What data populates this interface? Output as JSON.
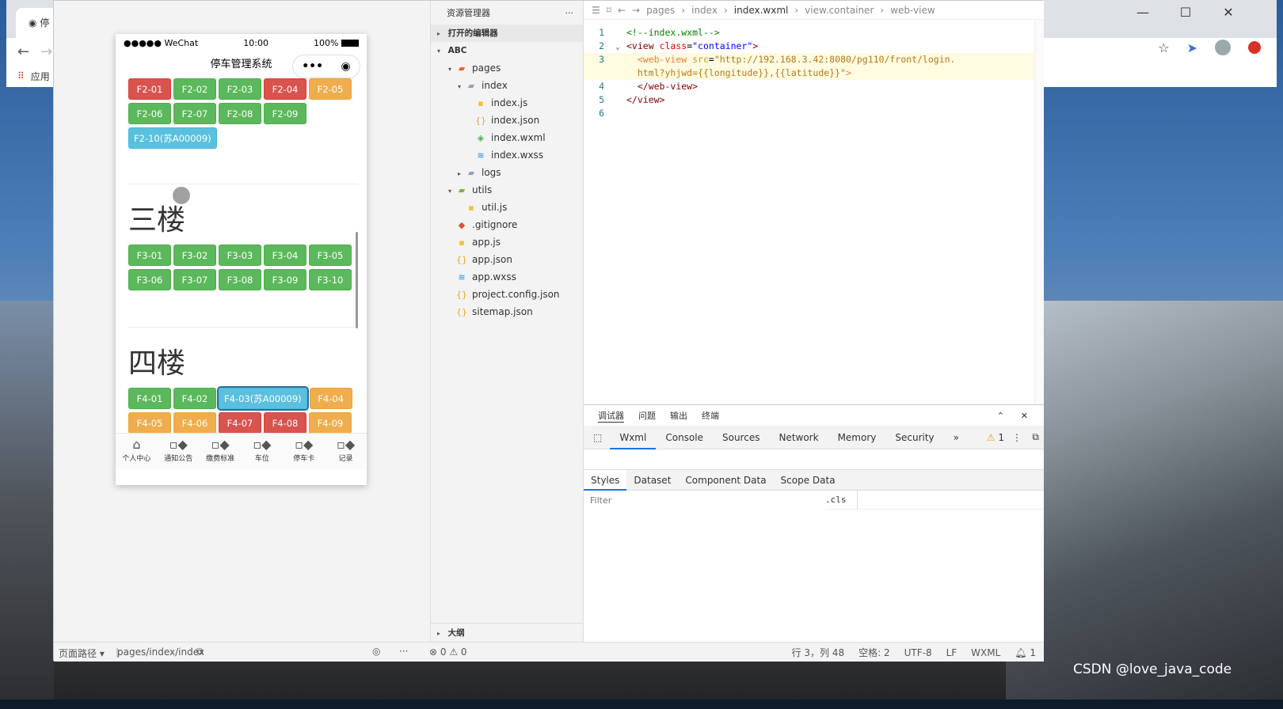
{
  "chrome": {
    "tab_label": "停",
    "bookmarks_label": "应用"
  },
  "simulator": {
    "status": {
      "carrier": "●●●●● WeChat",
      "time": "10:00",
      "battery": "100%"
    },
    "nav_title": "停车管理系统",
    "floor2_slots": [
      {
        "label": "F2-01",
        "status": "red"
      },
      {
        "label": "F2-02",
        "status": "green"
      },
      {
        "label": "F2-03",
        "status": "green"
      },
      {
        "label": "F2-04",
        "status": "red"
      },
      {
        "label": "F2-05",
        "status": "orange"
      },
      {
        "label": "F2-06",
        "status": "green"
      },
      {
        "label": "F2-07",
        "status": "green"
      },
      {
        "label": "F2-08",
        "status": "green"
      },
      {
        "label": "F2-09",
        "status": "green"
      },
      {
        "label": "F2-10(苏A00009)",
        "status": "blue"
      }
    ],
    "floor3_title": "三楼",
    "floor3_slots": [
      {
        "label": "F3-01",
        "status": "green"
      },
      {
        "label": "F3-02",
        "status": "green"
      },
      {
        "label": "F3-03",
        "status": "green"
      },
      {
        "label": "F3-04",
        "status": "green"
      },
      {
        "label": "F3-05",
        "status": "green"
      },
      {
        "label": "F3-06",
        "status": "green"
      },
      {
        "label": "F3-07",
        "status": "green"
      },
      {
        "label": "F3-08",
        "status": "green"
      },
      {
        "label": "F3-09",
        "status": "green"
      },
      {
        "label": "F3-10",
        "status": "green"
      }
    ],
    "floor4_title": "四楼",
    "floor4_slots": [
      {
        "label": "F4-01",
        "status": "green"
      },
      {
        "label": "F4-02",
        "status": "green"
      },
      {
        "label": "F4-03(苏A00009)",
        "status": "blue"
      },
      {
        "label": "F4-04",
        "status": "orange"
      },
      {
        "label": "F4-05",
        "status": "orange"
      },
      {
        "label": "F4-06",
        "status": "orange"
      },
      {
        "label": "F4-07",
        "status": "red"
      },
      {
        "label": "F4-08",
        "status": "red"
      },
      {
        "label": "F4-09",
        "status": "orange"
      }
    ],
    "tabbar": [
      {
        "label": "个人中心",
        "icon": "home-icon"
      },
      {
        "label": "通知公告",
        "icon": "grid-icon"
      },
      {
        "label": "缴费标准",
        "icon": "grid-icon"
      },
      {
        "label": "车位",
        "icon": "grid-icon"
      },
      {
        "label": "停车卡",
        "icon": "grid-icon"
      },
      {
        "label": "记录",
        "icon": "grid-icon"
      }
    ]
  },
  "explorer": {
    "title": "资源管理器",
    "open_editors": "打开的编辑器",
    "project": "ABC",
    "tree": [
      {
        "label": "pages",
        "depth": 1,
        "type": "folder-red",
        "arrow": "▾"
      },
      {
        "label": "index",
        "depth": 2,
        "type": "folder",
        "arrow": "▾"
      },
      {
        "label": "index.js",
        "depth": 3,
        "type": "js",
        "arrow": ""
      },
      {
        "label": "index.json",
        "depth": 3,
        "type": "json",
        "arrow": ""
      },
      {
        "label": "index.wxml",
        "depth": 3,
        "type": "wxml",
        "arrow": ""
      },
      {
        "label": "index.wxss",
        "depth": 3,
        "type": "wxss",
        "arrow": ""
      },
      {
        "label": "logs",
        "depth": 2,
        "type": "folder",
        "arrow": "▸"
      },
      {
        "label": "utils",
        "depth": 1,
        "type": "folder-green",
        "arrow": "▾"
      },
      {
        "label": "util.js",
        "depth": 2,
        "type": "js",
        "arrow": ""
      },
      {
        "label": ".gitignore",
        "depth": 1,
        "type": "git",
        "arrow": ""
      },
      {
        "label": "app.js",
        "depth": 1,
        "type": "js",
        "arrow": ""
      },
      {
        "label": "app.json",
        "depth": 1,
        "type": "json",
        "arrow": ""
      },
      {
        "label": "app.wxss",
        "depth": 1,
        "type": "wxss",
        "arrow": ""
      },
      {
        "label": "project.config.json",
        "depth": 1,
        "type": "json",
        "arrow": ""
      },
      {
        "label": "sitemap.json",
        "depth": 1,
        "type": "json",
        "arrow": ""
      }
    ],
    "outline": "大纲"
  },
  "editor": {
    "breadcrumb": [
      "pages",
      "index",
      "index.wxml",
      "view.container",
      "web-view"
    ],
    "lines": [
      {
        "n": "1",
        "fold": "",
        "html": "<span class=\"c-comment\">&lt;!--index.wxml--&gt;</span>"
      },
      {
        "n": "2",
        "fold": "⌄",
        "html": "<span class=\"c-tag\">&lt;view</span> <span class=\"c-attr\">class</span><span class=\"c-plain\">=</span><span class=\"c-str\">\"container\"</span><span class=\"c-tag\">&gt;</span>"
      },
      {
        "n": "3",
        "fold": "",
        "html": "  <span class=\"c-tag2\">&lt;web-view</span> <span class=\"c-attr2\">src</span><span class=\"c-plain\">=</span><span class=\"c-str2\">\"http://192.168.3.42:8080/pg110/front/login.</span>"
      },
      {
        "n": "",
        "fold": "",
        "html": "  <span class=\"c-str2\">html?yhjwd={{longitude}},{{latitude}}\"</span><span class=\"c-tag2\">&gt;</span>"
      },
      {
        "n": "4",
        "fold": "",
        "html": "  <span class=\"c-tag\">&lt;/web-view&gt;</span>"
      },
      {
        "n": "5",
        "fold": "",
        "html": "<span class=\"c-tag\">&lt;/view&gt;</span>"
      },
      {
        "n": "6",
        "fold": "",
        "html": ""
      }
    ]
  },
  "debugger": {
    "top_tabs": [
      "调试器",
      "问题",
      "输出",
      "终端"
    ],
    "tabs": [
      "Wxml",
      "Console",
      "Sources",
      "Network",
      "Memory",
      "Security"
    ],
    "warning_count": "1",
    "style_tabs": [
      "Styles",
      "Dataset",
      "Component Data",
      "Scope Data"
    ],
    "filter_placeholder": "Filter",
    "cls": ".cls"
  },
  "footer": {
    "path_label": "页面路径 ▾",
    "path": "pages/index/index",
    "errors": "⊗ 0 ⚠ 0",
    "cursor": "行 3，列 48",
    "spaces": "空格: 2",
    "encoding": "UTF-8",
    "eol": "LF",
    "lang": "WXML",
    "notif": "1"
  },
  "watermark": "CSDN @love_java_code"
}
